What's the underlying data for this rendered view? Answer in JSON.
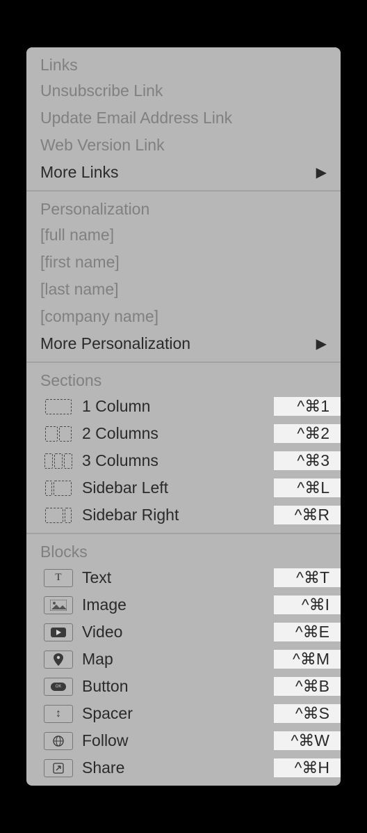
{
  "section1": {
    "heading": "Links",
    "items": [
      "Unsubscribe Link",
      "Update Email Address Link",
      "Web Version Link"
    ],
    "more": "More Links"
  },
  "section2": {
    "heading": "Personalization",
    "items": [
      "[full name]",
      "[first name]",
      "[last name]",
      "[company name]"
    ],
    "more": "More Personalization"
  },
  "section3": {
    "heading": "Sections",
    "rows": [
      {
        "label": "1 Column",
        "shortcut": "^⌘1"
      },
      {
        "label": "2 Columns",
        "shortcut": "^⌘2"
      },
      {
        "label": "3 Columns",
        "shortcut": "^⌘3"
      },
      {
        "label": "Sidebar Left",
        "shortcut": "^⌘L"
      },
      {
        "label": "Sidebar Right",
        "shortcut": "^⌘R"
      }
    ]
  },
  "section4": {
    "heading": "Blocks",
    "rows": [
      {
        "label": "Text",
        "shortcut": "^⌘T"
      },
      {
        "label": "Image",
        "shortcut": "^⌘I"
      },
      {
        "label": "Video",
        "shortcut": "^⌘E"
      },
      {
        "label": "Map",
        "shortcut": "^⌘M"
      },
      {
        "label": "Button",
        "shortcut": "^⌘B"
      },
      {
        "label": "Spacer",
        "shortcut": "^⌘S"
      },
      {
        "label": "Follow",
        "shortcut": "^⌘W"
      },
      {
        "label": "Share",
        "shortcut": "^⌘H"
      }
    ]
  }
}
